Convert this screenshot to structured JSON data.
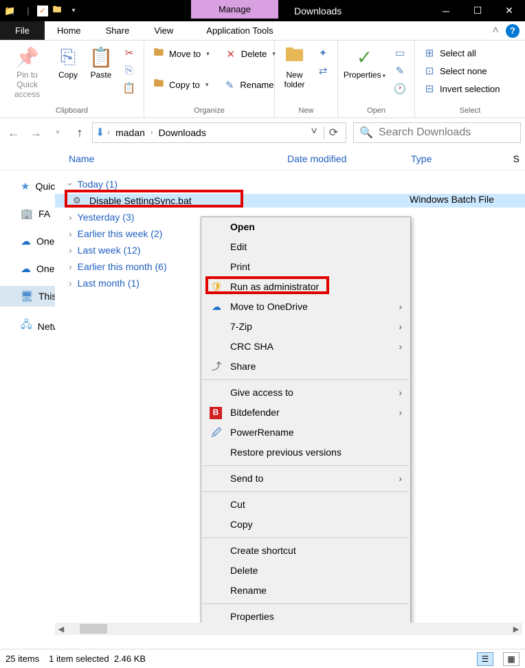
{
  "titlebar": {
    "manage": "Manage",
    "title": "Downloads"
  },
  "menubar": {
    "file": "File",
    "home": "Home",
    "share": "Share",
    "view": "View",
    "apptools": "Application Tools"
  },
  "ribbon": {
    "clipboard": {
      "label": "Clipboard",
      "pin": "Pin to Quick access",
      "copy": "Copy",
      "paste": "Paste"
    },
    "organize": {
      "label": "Organize",
      "moveto": "Move to",
      "copyto": "Copy to",
      "delete": "Delete",
      "rename": "Rename"
    },
    "new": {
      "label": "New",
      "newfolder": "New folder"
    },
    "open": {
      "label": "Open",
      "properties": "Properties"
    },
    "select": {
      "label": "Select",
      "selectall": "Select all",
      "selectnone": "Select none",
      "invert": "Invert selection"
    }
  },
  "address": {
    "crumb1": "madan",
    "crumb2": "Downloads",
    "search_placeholder": "Search Downloads"
  },
  "columns": {
    "name": "Name",
    "date": "Date modified",
    "type": "Type",
    "s": "S"
  },
  "tree": {
    "quick": "Quick access",
    "fa": "FA",
    "on1": "OneDrive",
    "on2": "OneDrive",
    "thispc": "This PC",
    "network": "Network"
  },
  "groups": {
    "today": "Today (1)",
    "yesterday": "Yesterday (3)",
    "thisweek": "Earlier this week (2)",
    "lastweek": "Last week (12)",
    "thismonth": "Earlier this month (6)",
    "lastmonth": "Last month (1)"
  },
  "file": {
    "name": "Disable SettingSync.bat",
    "type": "Windows Batch File"
  },
  "context": {
    "open": "Open",
    "edit": "Edit",
    "print": "Print",
    "runas": "Run as administrator",
    "onedrive": "Move to OneDrive",
    "sevenzip": "7-Zip",
    "crcsha": "CRC SHA",
    "share": "Share",
    "giveaccess": "Give access to",
    "bitdefender": "Bitdefender",
    "powerrename": "PowerRename",
    "restore": "Restore previous versions",
    "sendto": "Send to",
    "cut": "Cut",
    "copy": "Copy",
    "shortcut": "Create shortcut",
    "delete": "Delete",
    "rename": "Rename",
    "properties": "Properties"
  },
  "status": {
    "items": "25 items",
    "selected": "1 item selected",
    "size": "2.46 KB"
  }
}
